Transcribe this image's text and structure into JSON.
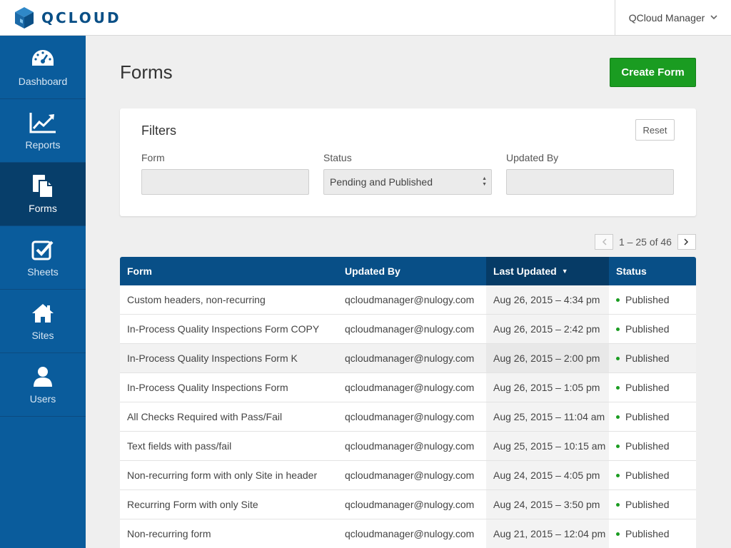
{
  "app": {
    "brand": "QCLOUD",
    "user_menu": "QCloud Manager",
    "accent": "#0a5c9c",
    "create_color": "#1a9c21"
  },
  "sidebar": {
    "items": [
      {
        "label": "Dashboard",
        "icon": "dashboard-gauge-icon"
      },
      {
        "label": "Reports",
        "icon": "line-chart-icon"
      },
      {
        "label": "Forms",
        "icon": "documents-icon",
        "active": true
      },
      {
        "label": "Sheets",
        "icon": "checkbox-icon"
      },
      {
        "label": "Sites",
        "icon": "home-icon"
      },
      {
        "label": "Users",
        "icon": "user-icon"
      }
    ]
  },
  "page": {
    "title": "Forms",
    "create_button": "Create Form"
  },
  "filters": {
    "title": "Filters",
    "reset": "Reset",
    "form_label": "Form",
    "form_value": "",
    "status_label": "Status",
    "status_value": "Pending and Published",
    "updated_by_label": "Updated By",
    "updated_by_value": ""
  },
  "pagination": {
    "text": "1 – 25 of 46"
  },
  "table": {
    "columns": [
      "Form",
      "Updated By",
      "Last Updated",
      "Status"
    ],
    "sorted_column": "Last Updated",
    "rows": [
      {
        "form": "Custom headers, non-recurring",
        "updated_by": "qcloudmanager@nulogy.com",
        "last_updated": "Aug 26, 2015 – 4:34 pm",
        "status": "Published"
      },
      {
        "form": "In-Process Quality Inspections Form COPY",
        "updated_by": "qcloudmanager@nulogy.com",
        "last_updated": "Aug 26, 2015 – 2:42 pm",
        "status": "Published"
      },
      {
        "form": "In-Process Quality Inspections Form K",
        "updated_by": "qcloudmanager@nulogy.com",
        "last_updated": "Aug 26, 2015 – 2:00 pm",
        "status": "Published"
      },
      {
        "form": "In-Process Quality Inspections Form",
        "updated_by": "qcloudmanager@nulogy.com",
        "last_updated": "Aug 26, 2015 – 1:05 pm",
        "status": "Published"
      },
      {
        "form": "All Checks Required with Pass/Fail",
        "updated_by": "qcloudmanager@nulogy.com",
        "last_updated": "Aug 25, 2015 – 11:04 am",
        "status": "Published"
      },
      {
        "form": "Text fields with pass/fail",
        "updated_by": "qcloudmanager@nulogy.com",
        "last_updated": "Aug 25, 2015 – 10:15 am",
        "status": "Published"
      },
      {
        "form": "Non-recurring form with only Site in header",
        "updated_by": "qcloudmanager@nulogy.com",
        "last_updated": "Aug 24, 2015 – 4:05 pm",
        "status": "Published"
      },
      {
        "form": "Recurring Form with only Site",
        "updated_by": "qcloudmanager@nulogy.com",
        "last_updated": "Aug 24, 2015 – 3:50 pm",
        "status": "Published"
      },
      {
        "form": "Non-recurring form",
        "updated_by": "qcloudmanager@nulogy.com",
        "last_updated": "Aug 21, 2015 – 12:04 pm",
        "status": "Published"
      }
    ]
  }
}
